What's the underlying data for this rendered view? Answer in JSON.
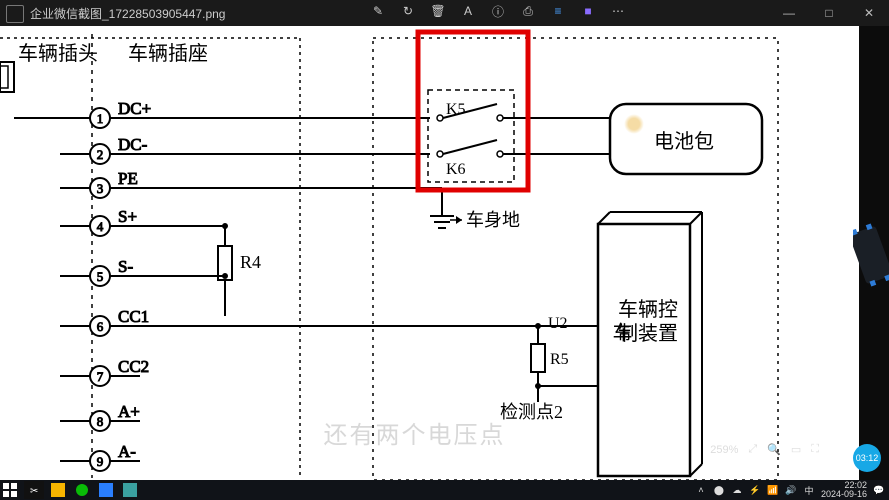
{
  "title_bar": {
    "filename": "企业微信截图_17228503905447.png"
  },
  "center_tools": {
    "edit": "✎",
    "rotate": "↻",
    "trash": "🗑",
    "ocr": "A",
    "info": "ⓘ",
    "print": "⎙",
    "share": "≡",
    "app": "■",
    "more": "⋯"
  },
  "window_controls": {
    "min": "—",
    "max": "□",
    "close": "✕"
  },
  "viewer": {
    "zoom_pct": "259%",
    "zoom_out": "⤢",
    "zoom_in": "🔍",
    "fit": "▭",
    "slideshow": "⛶"
  },
  "subtitle_text": "还有两个电压点",
  "timer_badge": "03:12",
  "taskbar": {
    "clock_time": "22:02",
    "clock_date": "2024-09-16"
  },
  "diagram": {
    "header_plug": "车辆插头",
    "header_socket": "车辆插座",
    "pins": [
      {
        "n": "1",
        "label": "DC+"
      },
      {
        "n": "2",
        "label": "DC-"
      },
      {
        "n": "3",
        "label": "PE"
      },
      {
        "n": "4",
        "label": "S+"
      },
      {
        "n": "5",
        "label": "S-"
      },
      {
        "n": "6",
        "label": "CC1"
      },
      {
        "n": "7",
        "label": "CC2"
      },
      {
        "n": "8",
        "label": "A+"
      },
      {
        "n": "9",
        "label": "A-"
      }
    ],
    "relay_k5": "K5",
    "relay_k6": "K6",
    "r4": "R4",
    "r5": "R5",
    "u2": "U2",
    "battery_pack": "电池包",
    "body_ground": "车身地",
    "vehicle_ctrl": "车辆控制装置",
    "test_point2": "检测点2"
  }
}
